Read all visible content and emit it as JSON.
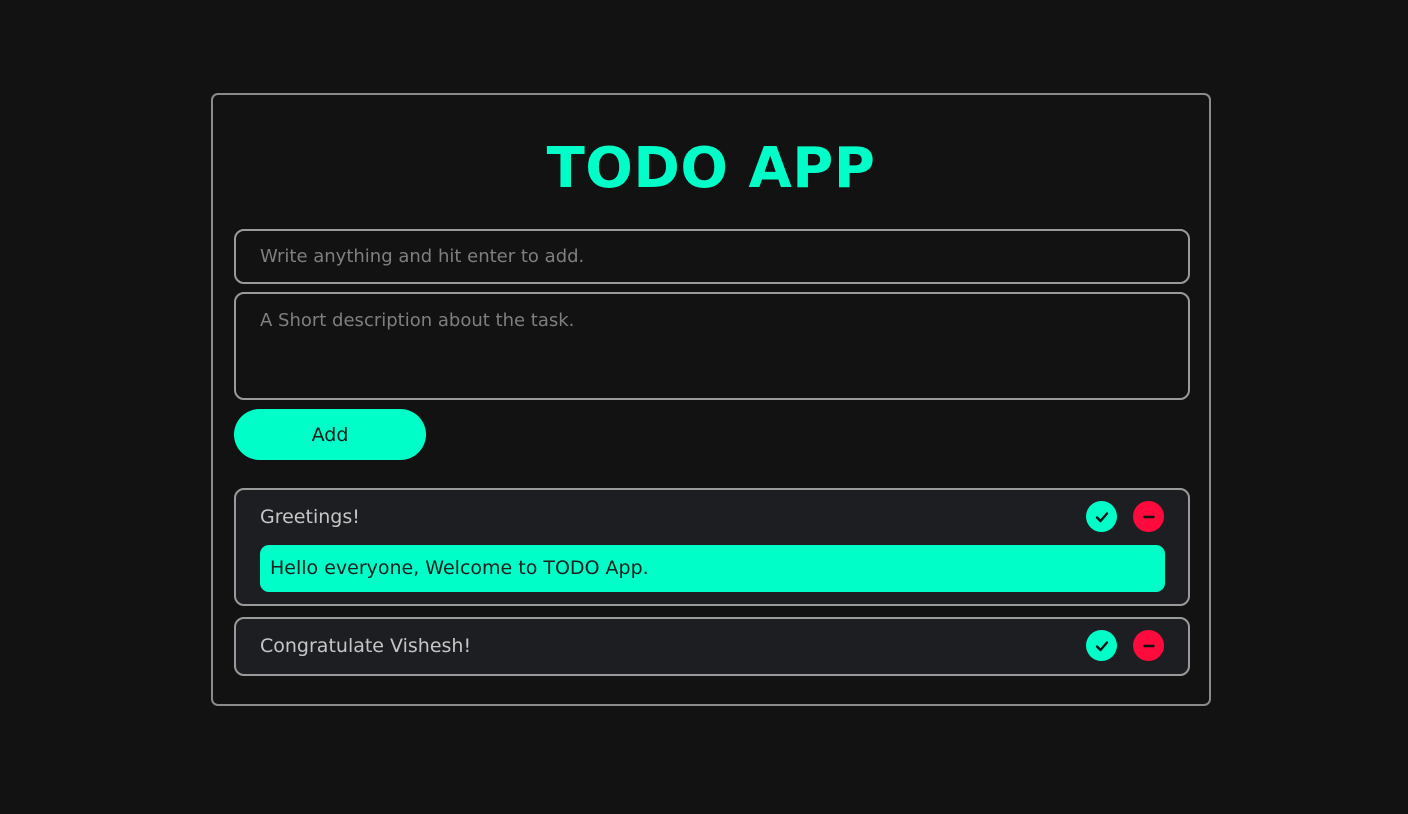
{
  "app": {
    "title": "TODO APP"
  },
  "form": {
    "title_placeholder": "Write anything and hit enter to add.",
    "title_value": "",
    "description_placeholder": "A Short description about the task.",
    "description_value": "",
    "add_label": "Add"
  },
  "todos": [
    {
      "title": "Greetings!",
      "description": "Hello everyone, Welcome to TODO App.",
      "complete_icon": "check-icon",
      "remove_icon": "minus-icon"
    },
    {
      "title": "Congratulate Vishesh!",
      "complete_icon": "check-icon",
      "remove_icon": "minus-icon"
    }
  ],
  "colors": {
    "accent": "#00ffc8",
    "danger": "#ff0a3c",
    "background": "#121212",
    "card": "#1d1e22"
  }
}
